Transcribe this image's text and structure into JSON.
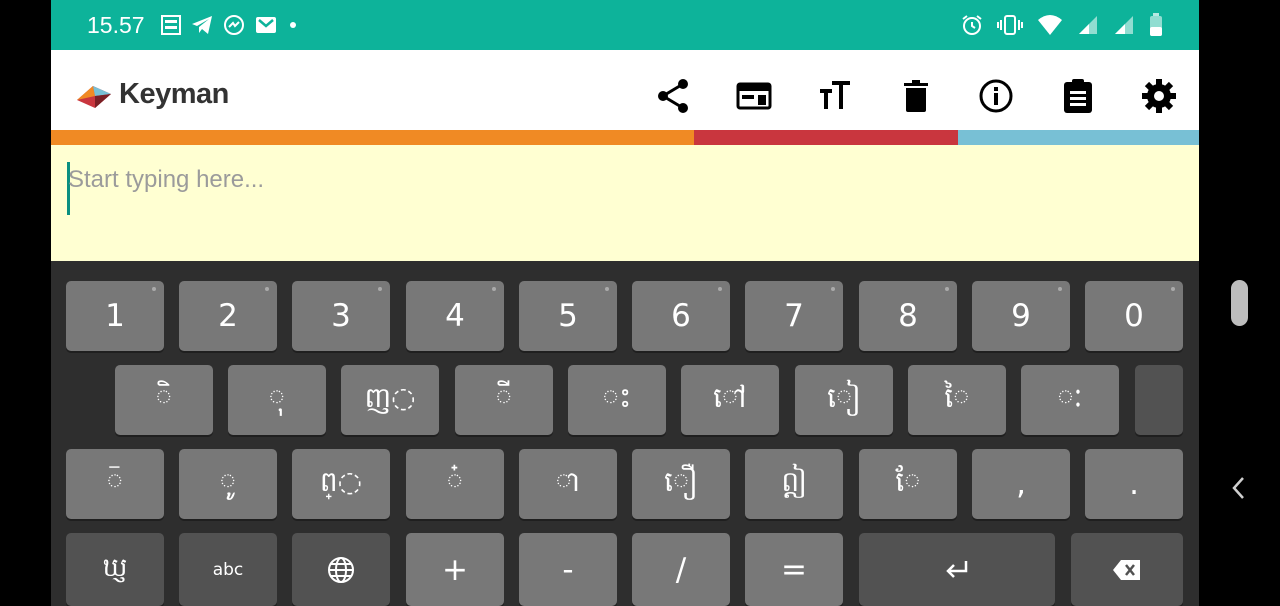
{
  "status": {
    "time": "15.57",
    "left_icons": [
      "jazz-icon",
      "telegram-icon",
      "messenger-icon",
      "gmail-icon",
      "dot-icon"
    ],
    "right_icons": [
      "alarm-icon",
      "vibrate-icon",
      "wifi-icon",
      "signal-icon",
      "signal-icon",
      "battery-icon"
    ]
  },
  "app": {
    "name": "Keyman",
    "toolbar": [
      "share-icon",
      "keyboard-layout-icon",
      "text-size-icon",
      "delete-icon",
      "info-icon",
      "clipboard-icon",
      "settings-icon"
    ]
  },
  "colors": {
    "status_bar": "#0db39a",
    "stripe_orange": "#f08a24",
    "stripe_red": "#c9363e",
    "stripe_blue": "#78c0d5",
    "editor_bg": "#ffffd2"
  },
  "editor": {
    "placeholder": "Start typing here..."
  },
  "keyboard": {
    "row1": [
      "1",
      "2",
      "3",
      "4",
      "5",
      "6",
      "7",
      "8",
      "9",
      "0"
    ],
    "row2": [
      "◌ិ",
      "◌ុ",
      "ញ◌",
      "◌ី",
      "◌ះ",
      "◌ៅ",
      "◌ៀ",
      "◌ៃ",
      "ៈ",
      ""
    ],
    "row3": [
      "◌៑",
      "◌ូ",
      "ព្◌",
      "◌៎",
      "◌ា",
      "ឿ",
      "ឦ",
      "◌ែ",
      ",",
      "."
    ],
    "row4": {
      "lang_key": "ឃ្ញ",
      "abc": "abc",
      "globe_icon": "globe-icon",
      "plus": "+",
      "minus": "-",
      "slash": "/",
      "equals": "=",
      "enter_icon": "enter-icon",
      "backspace_icon": "backspace-icon"
    }
  }
}
